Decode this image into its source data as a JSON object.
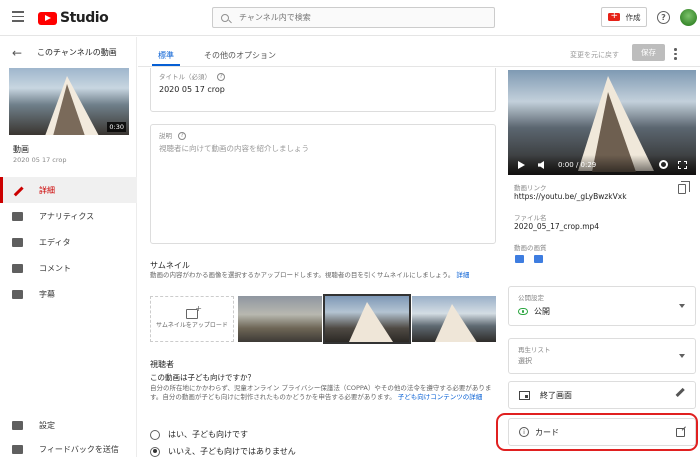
{
  "topbar": {
    "logo_text": "Studio",
    "search_placeholder": "チャンネル内で検索",
    "create_label": "作成"
  },
  "sidebar": {
    "header_title": "このチャンネルの動画",
    "thumbnail_duration": "0:30",
    "video_title": "動画",
    "video_subtitle": "2020 05 17 crop",
    "items": [
      {
        "label": "詳細",
        "icon": "pencil-icon",
        "active": true
      },
      {
        "label": "アナリティクス",
        "icon": "analytics-icon"
      },
      {
        "label": "エディタ",
        "icon": "editor-icon"
      },
      {
        "label": "コメント",
        "icon": "comment-icon"
      },
      {
        "label": "字幕",
        "icon": "subtitles-icon"
      }
    ],
    "bottom_items": [
      {
        "label": "設定",
        "icon": "gear-icon"
      },
      {
        "label": "フィードバックを送信",
        "icon": "feedback-icon"
      }
    ]
  },
  "tabs": {
    "standard": "標準",
    "other_options": "その他のオプション",
    "revert": "変更を元に戻す",
    "save": "保存"
  },
  "form": {
    "title_label": "タイトル（必須）",
    "title_value": "2020 05 17 crop",
    "description_label": "説明",
    "description_placeholder": "視聴者に向けて動画の内容を紹介しましょう",
    "thumbnail_title": "サムネイル",
    "thumbnail_desc": "動画の内容がわかる画像を選択するかアップロードします。視聴者の目を引くサムネイルにしましょう。",
    "thumbnail_desc_link": "詳細",
    "thumbnail_upload": "サムネイルをアップロード",
    "audience_title": "視聴者",
    "audience_question": "この動画は子ども向けですか？",
    "audience_desc": "自分の所在地にかかわらず、児童オンライン プライバシー保護法（COPPA）やその他の法令を遵守する必要があります。自分の動画が子ども向けに制作されたものかどうかを申告する必要があります。",
    "audience_desc_link": "子ども向けコンテンツの詳細",
    "radio_yes": "はい、子ども向けです",
    "radio_no": "いいえ、子ども向けではありません"
  },
  "right": {
    "player_time": "0:00 / 0:29",
    "video_link_label": "動画リンク",
    "video_link": "https://youtu.be/_gLyBwzkVxk",
    "filename_label": "ファイル名",
    "filename": "2020_05_17_crop.mp4",
    "quality_label": "動画の画質",
    "visibility_label": "公開設定",
    "visibility_value": "公開",
    "playlist_label": "再生リスト",
    "playlist_value": "選択",
    "end_screen": "終了画面",
    "cards": "カード"
  }
}
